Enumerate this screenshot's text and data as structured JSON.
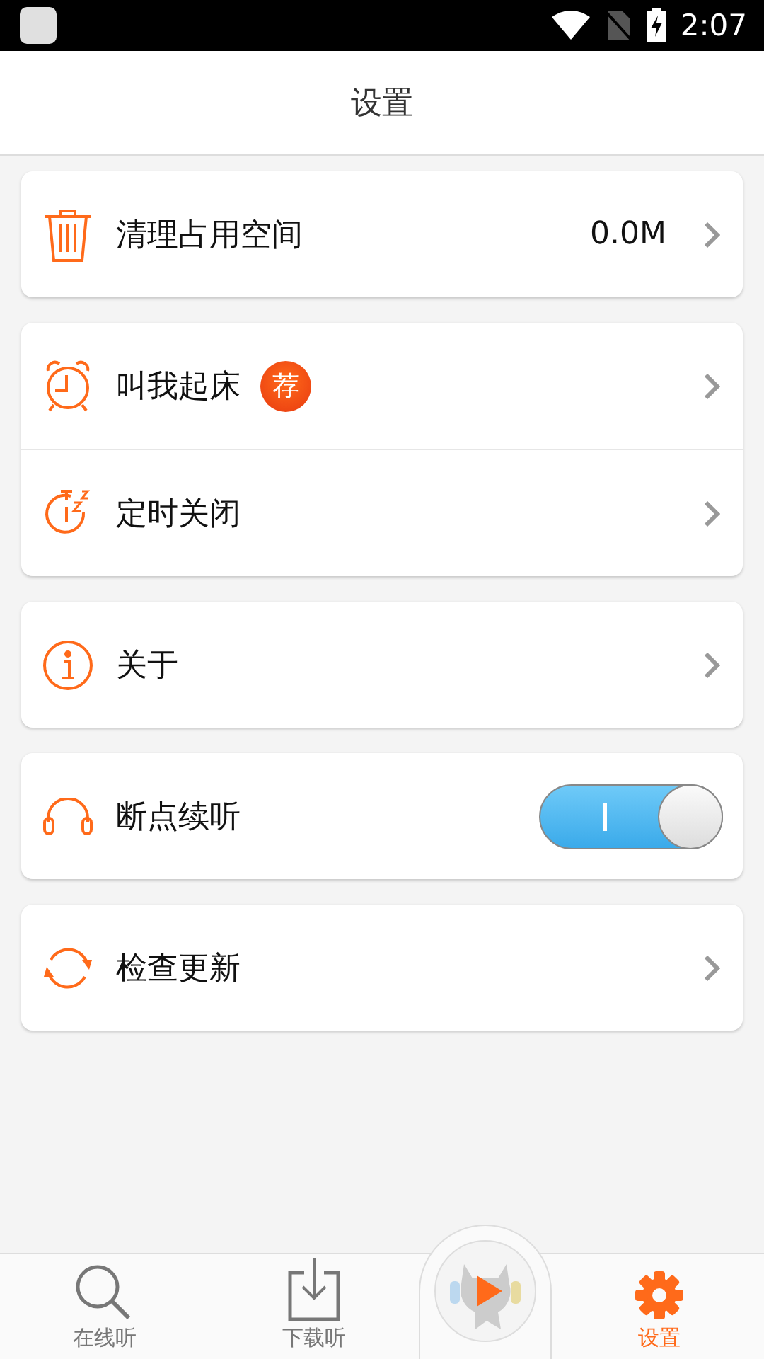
{
  "status_bar": {
    "time": "2:07"
  },
  "header": {
    "title": "设置"
  },
  "groups": [
    {
      "items": [
        {
          "kind": "chevron",
          "label": "清理占用空间",
          "value": "0.0M"
        }
      ]
    },
    {
      "items": [
        {
          "kind": "chevron",
          "label": "叫我起床",
          "badge": "荐"
        },
        {
          "kind": "chevron",
          "label": "定时关闭"
        }
      ]
    },
    {
      "items": [
        {
          "kind": "chevron",
          "label": "关于"
        }
      ]
    },
    {
      "items": [
        {
          "kind": "toggle",
          "label": "断点续听",
          "on": true
        }
      ]
    },
    {
      "items": [
        {
          "kind": "chevron",
          "label": "检查更新"
        }
      ]
    }
  ],
  "bottom_nav": [
    {
      "kind": "tab",
      "label": "在线听",
      "selected": false
    },
    {
      "kind": "tab",
      "label": "下载听",
      "selected": false
    },
    {
      "kind": "player"
    },
    {
      "kind": "tab",
      "label": "设置",
      "selected": true
    }
  ]
}
